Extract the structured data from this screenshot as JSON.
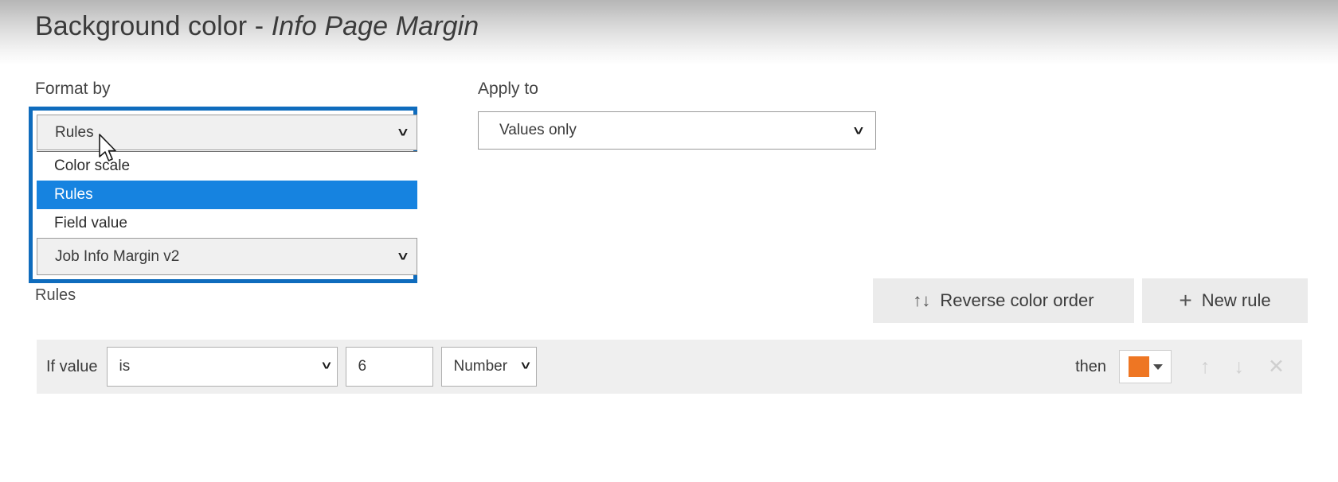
{
  "dialog": {
    "title_main": "Background color - ",
    "title_field": "Info Page Margin"
  },
  "format_by": {
    "label": "Format by",
    "selected": "Rules",
    "chevron": "chevron-down-icon",
    "options": [
      {
        "label": "Color scale",
        "selected": false
      },
      {
        "label": "Rules",
        "selected": true
      },
      {
        "label": "Field value",
        "selected": false
      }
    ],
    "field_selected": "Job Info Margin v2",
    "focus_color": "#0f6cbd",
    "highlight_color": "#1683e0"
  },
  "apply_to": {
    "label": "Apply to",
    "selected": "Values only",
    "chevron": "chevron-down-icon"
  },
  "rules_section": {
    "label": "Rules",
    "reverse_button": {
      "icon": "↑↓",
      "label": "Reverse color order"
    },
    "new_rule_button": {
      "icon": "+",
      "label": "New rule"
    }
  },
  "rule": {
    "if_value_label": "If value",
    "condition": "is",
    "value": "6",
    "value_type": "Number",
    "then_label": "then",
    "color": "#ee7623",
    "actions": {
      "move_up": "↑",
      "move_down": "↓",
      "remove": "✕"
    }
  }
}
